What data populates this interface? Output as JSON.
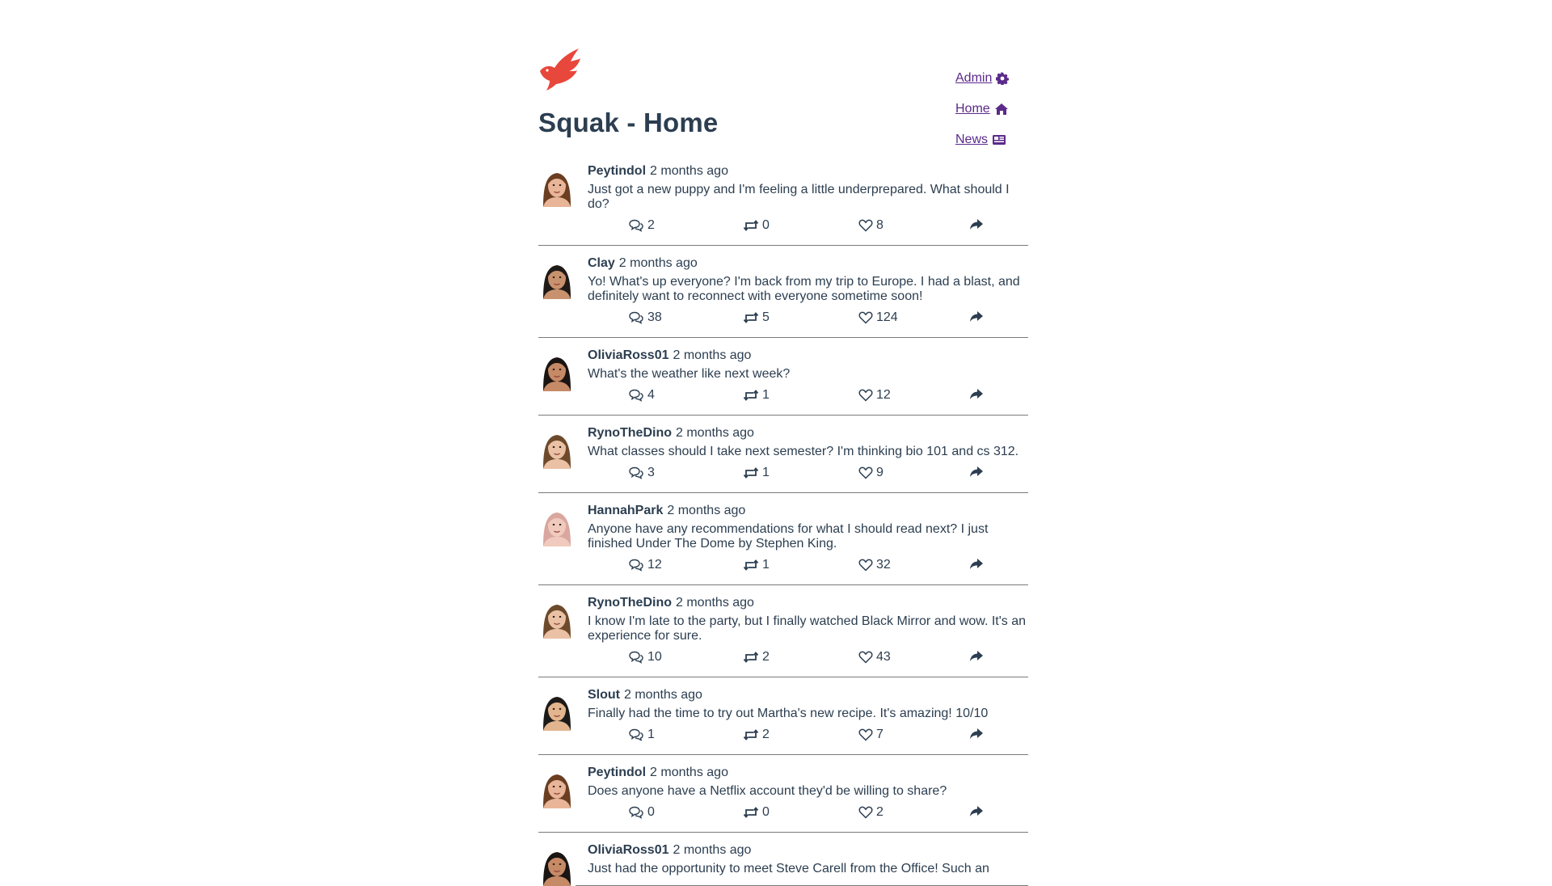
{
  "header": {
    "title": "Squak - Home"
  },
  "nav": {
    "admin": "Admin",
    "home": "Home",
    "news": "News"
  },
  "colors": {
    "accent": "#5b2a8a",
    "text": "#2c3e50",
    "logo": "#e8473c"
  },
  "posts": [
    {
      "username": "Peytindol",
      "time": "2 months ago",
      "text": "Just got a new puppy and I'm feeling a little underprepared. What should I do?",
      "replies": "2",
      "retweets": "0",
      "likes": "8",
      "skin": "#e8b598",
      "hair": "#6b3e22"
    },
    {
      "username": "Clay",
      "time": "2 months ago",
      "text": "Yo! What's up everyone? I'm back from my trip to Europe. I had a blast, and definitely want to reconnect with everyone sometime soon!",
      "replies": "38",
      "retweets": "5",
      "likes": "124",
      "skin": "#c9926e",
      "hair": "#1f1a17"
    },
    {
      "username": "OliviaRoss01",
      "time": "2 months ago",
      "text": "What's the weather like next week?",
      "replies": "4",
      "retweets": "1",
      "likes": "12",
      "skin": "#c68a66",
      "hair": "#1a1412"
    },
    {
      "username": "RynoTheDino",
      "time": "2 months ago",
      "text": "What classes should I take next semester? I'm thinking bio 101 and cs 312.",
      "replies": "3",
      "retweets": "1",
      "likes": "9",
      "skin": "#eac1a4",
      "hair": "#6e4a2c"
    },
    {
      "username": "HannahPark",
      "time": "2 months ago",
      "text": "Anyone have any recommendations for what I should read next? I just finished Under The Dome by Stephen King.",
      "replies": "12",
      "retweets": "1",
      "likes": "32",
      "skin": "#f0cbbd",
      "hair": "#d9a7a0"
    },
    {
      "username": "RynoTheDino",
      "time": "2 months ago",
      "text": "I know I'm late to the party, but I finally watched Black Mirror and wow. It's an experience for sure.",
      "replies": "10",
      "retweets": "2",
      "likes": "43",
      "skin": "#eac1a4",
      "hair": "#6e4a2c"
    },
    {
      "username": "Slout",
      "time": "2 months ago",
      "text": "Finally had the time to try out Martha's new recipe. It's amazing! 10/10",
      "replies": "1",
      "retweets": "2",
      "likes": "7",
      "skin": "#e2b58e",
      "hair": "#1c1a18"
    },
    {
      "username": "Peytindol",
      "time": "2 months ago",
      "text": "Does anyone have a Netflix account they'd be willing to share?",
      "replies": "0",
      "retweets": "0",
      "likes": "2",
      "skin": "#e8b598",
      "hair": "#6b3e22"
    },
    {
      "username": "OliviaRoss01",
      "time": "2 months ago",
      "text": "Just had the opportunity to meet Steve Carell from the Office! Such an",
      "replies": "",
      "retweets": "",
      "likes": "",
      "skin": "#c68a66",
      "hair": "#1a1412"
    }
  ]
}
